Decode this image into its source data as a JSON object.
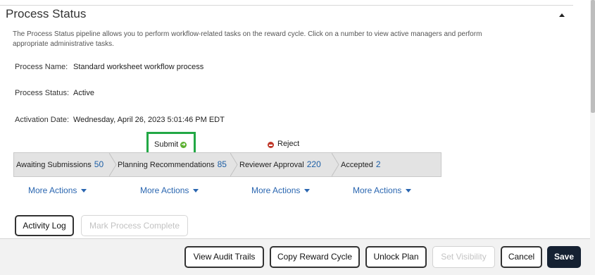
{
  "section": {
    "title": "Process Status",
    "description": "The Process Status pipeline allows you to perform workflow-related tasks on the reward cycle. Click on a number to view active managers and perform appropriate administrative tasks."
  },
  "fields": {
    "process_name_label": "Process Name:",
    "process_name_value": "Standard worksheet workflow process",
    "process_status_label": "Process Status:",
    "process_status_value": "Active",
    "activation_date_label": "Activation Date:",
    "activation_date_value": "Wednesday, April 26, 2023 5:01:46 PM EDT"
  },
  "actions": {
    "submit_label": "Submit",
    "reject_label": "Reject"
  },
  "pipeline": {
    "stages": [
      {
        "label": "Awaiting Submissions",
        "count": "50"
      },
      {
        "label": "Planning Recommendations",
        "count": "85"
      },
      {
        "label": "Reviewer Approval",
        "count": "220"
      },
      {
        "label": "Accepted",
        "count": "2"
      }
    ],
    "more_actions_label": "More Actions"
  },
  "buttons": {
    "activity_log": "Activity Log",
    "mark_complete": "Mark Process Complete"
  },
  "footer": {
    "view_audit_trails": "View Audit Trails",
    "copy_reward_cycle": "Copy Reward Cycle",
    "unlock_plan": "Unlock Plan",
    "set_visibility": "Set Visibility",
    "cancel": "Cancel",
    "save": "Save"
  },
  "colors": {
    "submit_highlight": "#22a845",
    "link": "#2a66b0",
    "primary_button": "#152132"
  }
}
